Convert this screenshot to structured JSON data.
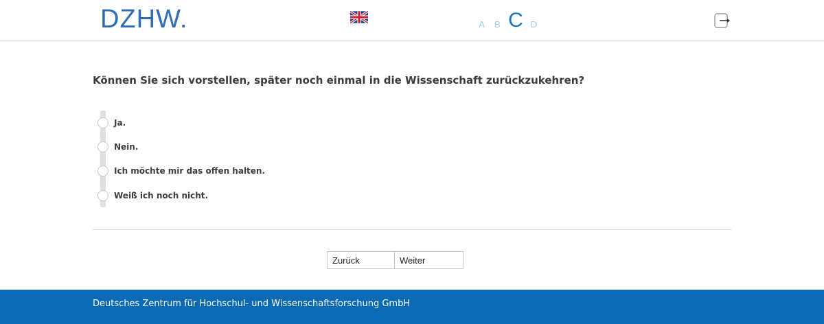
{
  "header": {
    "logo_text": "DZHW",
    "logo_dot": ".",
    "language_flag": "uk-flag-icon",
    "modules": [
      {
        "label": "A",
        "active": false
      },
      {
        "label": "B",
        "active": false
      },
      {
        "label": "C",
        "active": true
      },
      {
        "label": "D",
        "active": false
      }
    ],
    "logout_icon": "logout-icon"
  },
  "question": {
    "text": "Können Sie sich vorstellen, später noch einmal in die Wissenschaft zurückzukehren?",
    "options": [
      {
        "label": "Ja."
      },
      {
        "label": "Nein."
      },
      {
        "label": "Ich möchte mir das offen halten."
      },
      {
        "label": "Weiß ich noch nicht."
      }
    ]
  },
  "navigation": {
    "back_label": "Zurück",
    "next_label": "Weiter"
  },
  "footer": {
    "text": "Deutsches Zentrum für Hochschul- und Wissenschaftsforschung GmbH"
  },
  "colors": {
    "brand_blue": "#0b6ab4",
    "logo_blue": "#2f6db5",
    "module_inactive": "#a8c8e6"
  }
}
